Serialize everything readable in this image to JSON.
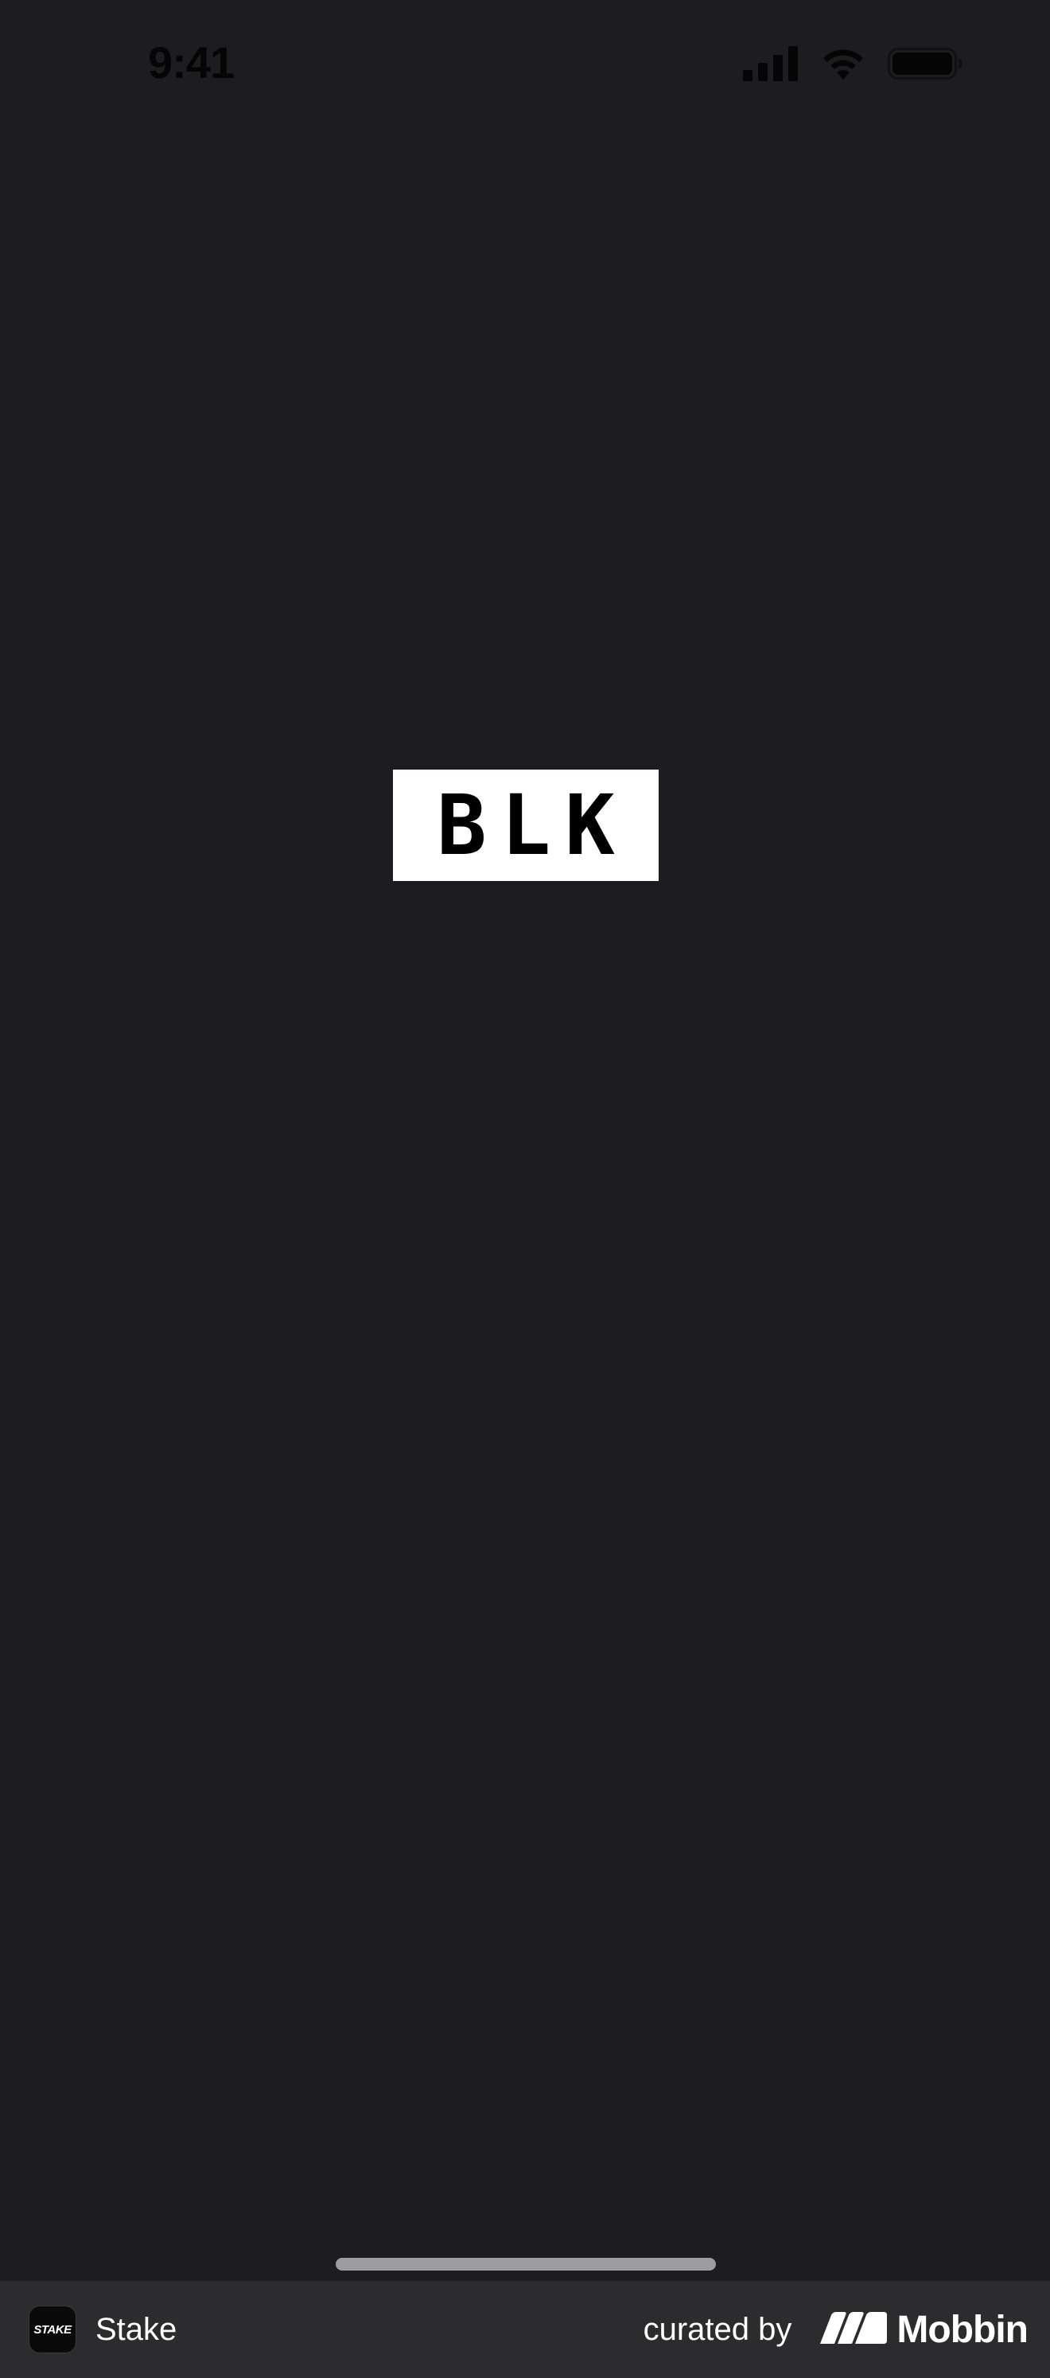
{
  "status_bar": {
    "time": "9:41",
    "icons": [
      "cellular-signal-icon",
      "wifi-icon",
      "battery-icon"
    ]
  },
  "logo": {
    "text": "BLK"
  },
  "footer": {
    "app_icon_text": "STAKE",
    "app_name": "Stake",
    "curated_label": "curated by",
    "brand_name": "Mobbin",
    "brand_icon": "mobbin-logo-icon"
  },
  "colors": {
    "background": "#1d1d21",
    "footer_background": "#2c2c2e",
    "logo_background": "#ffffff",
    "logo_text": "#000000",
    "home_indicator": "#9c9ca1"
  }
}
